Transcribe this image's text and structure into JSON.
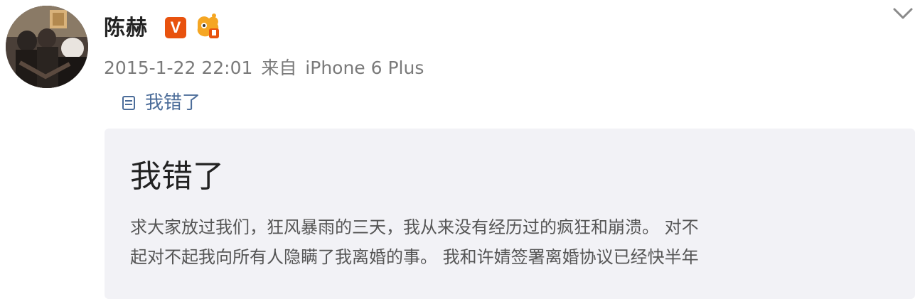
{
  "post": {
    "username": "陈赫",
    "verified_badge": "V",
    "member_badge_icon": "weibo-vip-icon",
    "timestamp": "2015-1-22 22:01",
    "source_prefix": "来自",
    "source_device": "iPhone 6 Plus",
    "more_icon": "chevron-down-icon"
  },
  "article": {
    "link_icon": "document-icon",
    "link_label": "我错了",
    "title": "我错了",
    "body_lines": [
      "求大家放过我们，狂风暴雨的三天，我从来没有经历过的疯狂和崩溃。 对不",
      "起对不起我向所有人隐瞒了我离婚的事。 我和许婧签署离婚协议已经快半年"
    ]
  },
  "colors": {
    "verified_badge": "#e8520e",
    "link_text": "#4b6c99",
    "card_background": "#f2f2f6",
    "meta_text": "#7a7a7a"
  }
}
